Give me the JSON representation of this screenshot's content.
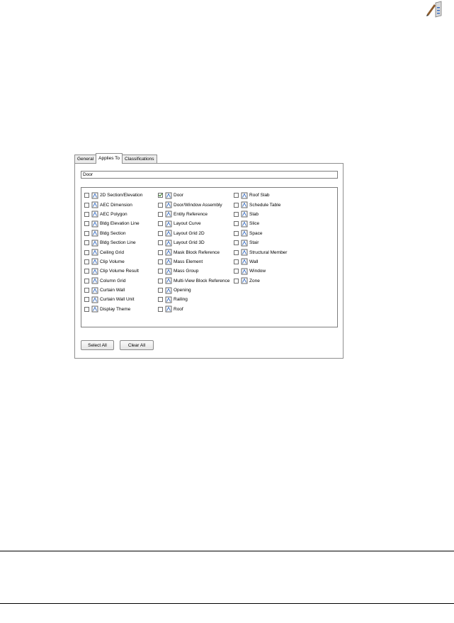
{
  "dialog": {
    "tabs": [
      {
        "label": "General",
        "active": false
      },
      {
        "label": "Applies To",
        "active": true
      },
      {
        "label": "Classifications",
        "active": false
      }
    ],
    "name_value": "Door",
    "columns": [
      [
        {
          "label": "2D Section/Elevation",
          "icon": "2d-section-elevation-icon",
          "checked": false
        },
        {
          "label": "AEC Dimension",
          "icon": "aec-dimension-icon",
          "checked": false
        },
        {
          "label": "AEC Polygon",
          "icon": "aec-polygon-icon",
          "checked": false
        },
        {
          "label": "Bldg Elevation Line",
          "icon": "bldg-elevation-line-icon",
          "checked": false
        },
        {
          "label": "Bldg Section",
          "icon": "bldg-section-icon",
          "checked": false
        },
        {
          "label": "Bldg Section Line",
          "icon": "bldg-section-line-icon",
          "checked": false
        },
        {
          "label": "Ceiling Grid",
          "icon": "ceiling-grid-icon",
          "checked": false
        },
        {
          "label": "Clip Volume",
          "icon": "clip-volume-icon",
          "checked": false
        },
        {
          "label": "Clip Volume Result",
          "icon": "clip-volume-result-icon",
          "checked": false
        },
        {
          "label": "Column Grid",
          "icon": "column-grid-icon",
          "checked": false
        },
        {
          "label": "Curtain Wall",
          "icon": "curtain-wall-icon",
          "checked": false
        },
        {
          "label": "Curtain Wall Unit",
          "icon": "curtain-wall-unit-icon",
          "checked": false
        },
        {
          "label": "Display Theme",
          "icon": "display-theme-icon",
          "checked": false
        }
      ],
      [
        {
          "label": "Door",
          "icon": "door-icon",
          "checked": true
        },
        {
          "label": "Door/Window Assembly",
          "icon": "door-window-assembly-icon",
          "checked": false
        },
        {
          "label": "Entity Reference",
          "icon": "entity-reference-icon",
          "checked": false
        },
        {
          "label": "Layout Curve",
          "icon": "layout-curve-icon",
          "checked": false
        },
        {
          "label": "Layout Grid 2D",
          "icon": "layout-grid-2d-icon",
          "checked": false
        },
        {
          "label": "Layout Grid 3D",
          "icon": "layout-grid-3d-icon",
          "checked": false
        },
        {
          "label": "Mask Block Reference",
          "icon": "mask-block-reference-icon",
          "checked": false
        },
        {
          "label": "Mass Element",
          "icon": "mass-element-icon",
          "checked": false
        },
        {
          "label": "Mass Group",
          "icon": "mass-group-icon",
          "checked": false
        },
        {
          "label": "Multi-View Block Reference",
          "icon": "multi-view-block-reference-icon",
          "checked": false
        },
        {
          "label": "Opening",
          "icon": "opening-icon",
          "checked": false
        },
        {
          "label": "Railing",
          "icon": "railing-icon",
          "checked": false
        },
        {
          "label": "Roof",
          "icon": "roof-icon",
          "checked": false
        }
      ],
      [
        {
          "label": "Roof Slab",
          "icon": "roof-slab-icon",
          "checked": false
        },
        {
          "label": "Schedule Table",
          "icon": "schedule-table-icon",
          "checked": false
        },
        {
          "label": "Slab",
          "icon": "slab-icon",
          "checked": false
        },
        {
          "label": "Slice",
          "icon": "slice-icon",
          "checked": false
        },
        {
          "label": "Space",
          "icon": "space-icon",
          "checked": false
        },
        {
          "label": "Stair",
          "icon": "stair-icon",
          "checked": false
        },
        {
          "label": "Structural Member",
          "icon": "structural-member-icon",
          "checked": false
        },
        {
          "label": "Wall",
          "icon": "wall-icon",
          "checked": false
        },
        {
          "label": "Window",
          "icon": "window-icon",
          "checked": false
        },
        {
          "label": "Zone",
          "icon": "zone-icon",
          "checked": false
        }
      ]
    ],
    "buttons": {
      "select_all": "Select All",
      "clear_all": "Clear All"
    }
  },
  "corner_icon": "pencil-properties-icon",
  "colors": {
    "icon_blue": "#3a6fc4",
    "icon_gray": "#555555",
    "check_green": "#2c7a1e",
    "border": "#8e8e8e"
  }
}
